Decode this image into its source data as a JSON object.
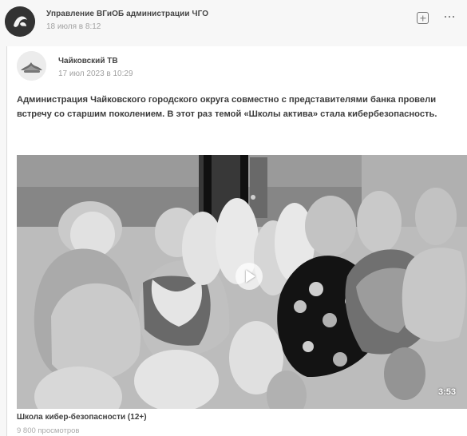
{
  "post": {
    "author": "Управление ВГиОБ администрации ЧГО",
    "time": "18 июля в 8:12"
  },
  "repost": {
    "author": "Чайковский ТВ",
    "date": "17 июл 2023 в 10:29",
    "text": "Администрация Чайковского городского округа совместно с представителями банка провели встречу со старшим поколением. В этот раз темой «Школы актива» стала кибербезопасность."
  },
  "video": {
    "duration": "3:53",
    "title": "Школа кибер-безопасности (12+)",
    "views": "9 800 просмотров"
  },
  "icons": {
    "avatar": "avatar-icon",
    "source_avatar": "tv-channel-logo",
    "plus": "plus-square-icon",
    "more": "more-icon",
    "play": "play-icon"
  }
}
